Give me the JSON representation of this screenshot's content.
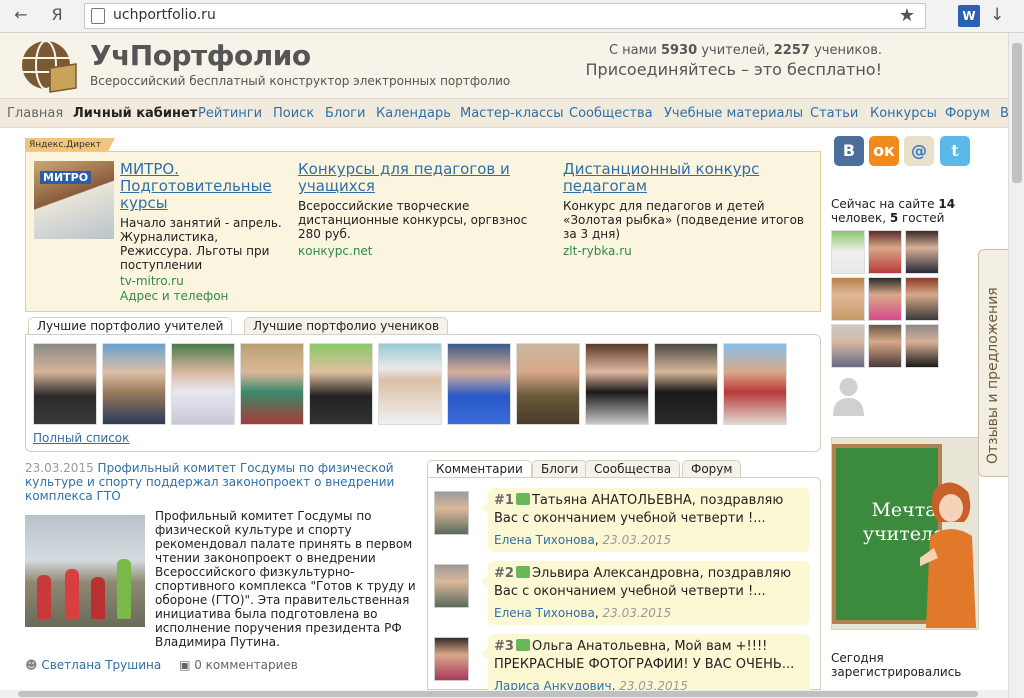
{
  "browser": {
    "back_icon": "←",
    "yandex_label": "Я",
    "url": "uchportfolio.ru",
    "star_icon": "★",
    "ext_label": "W",
    "download_icon": "↓"
  },
  "header": {
    "brand": "УчПортфолио",
    "tagline": "Всероссийский бесплатный конструктор электронных портфолио",
    "stats_prefix": "С нами ",
    "teachers_count": "5930",
    "stats_middle": " учителей, ",
    "students_count": "2257",
    "stats_suffix": " учеников.",
    "join": "Присоединяйтесь – это бесплатно!"
  },
  "nav": [
    "Главная",
    "Личный кабинет",
    "Рейтинги",
    "Поиск",
    "Блоги",
    "Календарь",
    "Мастер-классы",
    "Сообщества",
    "Учебные материалы",
    "Статьи",
    "Конкурсы",
    "Форум",
    "В"
  ],
  "ad": {
    "label": "Яндекс.Директ",
    "thumb_text": "МИТРО",
    "items": [
      {
        "title": "МИТРО. Подготовительные курсы",
        "body": "Начало занятий - апрель. Журналистика, Режиссура. Льготы при поступлении",
        "link": "tv-mitro.ru",
        "extra": "Адрес и телефон"
      },
      {
        "title": "Конкурсы для педагогов и учащихся",
        "body": "Всероссийские творческие дистанционные конкурсы, оргвзнос 280 руб.",
        "link": "конкурс.net"
      },
      {
        "title": "Дистанционный конкурс педагогам",
        "body": "Конкурс для педагогов и детей «Золотая рыбка» (подведение итогов за 3 дня)",
        "link": "zlt-rybka.ru"
      }
    ]
  },
  "portfolio_tabs": [
    "Лучшие портфолио учителей",
    "Лучшие портфолио учеников"
  ],
  "portfolio_full_list": "Полный список",
  "news": {
    "date": "23.03.2015",
    "title": "Профильный комитет Госдумы по физической культуре и спорту поддержал законопроект о внедрении комплекса ГТО",
    "text": "Профильный комитет Госдумы по физической культуре и спорту рекомендовал палате принять в первом чтении законопроект о внедрении Всероссийского физкультурно-спортивного комплекса \"Готов к труду и обороне (ГТО)\". Эта правительственная инициатива была подготовлена во исполнение поручения президента РФ Владимира Путина.",
    "author": "Светлана Трушина",
    "comments": "0 комментариев"
  },
  "comment_tabs": [
    "Комментарии",
    "Блоги",
    "Сообщества",
    "Форум"
  ],
  "comments": [
    {
      "num": "#1",
      "text": "Татьяна АНАТОЛЬЕВНА, поздравляю Вас с окончанием учебной четверти !...",
      "author": "Елена Тихонова",
      "date": "23.03.2015"
    },
    {
      "num": "#2",
      "text": "Эльвира Александровна, поздравляю Вас с окончанием учебной четверти !...",
      "author": "Елена Тихонова",
      "date": "23.03.2015"
    },
    {
      "num": "#3",
      "text": "Ольга Анатольевна, Мой вам +!!!! ПРЕКРАСНЫЕ ФОТОГРАФИИ! У ВАС ОЧЕНЬ...",
      "author": "Лариса Анкудович",
      "date": "23.03.2015"
    }
  ],
  "social": {
    "vk": "В",
    "ok": "ок",
    "mail": "@",
    "twitter": "t"
  },
  "online": {
    "prefix": "Сейчас на сайте ",
    "count": "14",
    "middle": " человек, ",
    "guests": "5",
    "suffix": " гостей"
  },
  "poster": {
    "text": "Мечта учителя"
  },
  "today": "Сегодня зарегистрировались",
  "feedback": "Отзывы и предложения"
}
